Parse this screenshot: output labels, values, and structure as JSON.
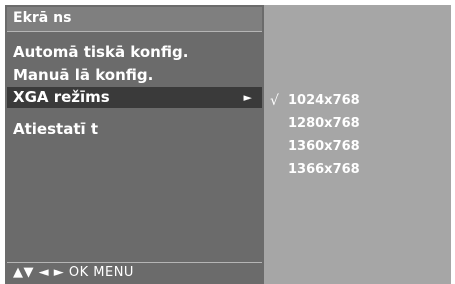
{
  "menu": {
    "title": "Ekrā ns",
    "items": [
      {
        "label": "Automā tiskā  konfig."
      },
      {
        "label": "Manuā lā  konfig."
      },
      {
        "label": "XGA režīms",
        "selected": true,
        "arrow": "►"
      },
      {
        "label": "Atiestatī t"
      }
    ],
    "hint": "▲▼  ◄ ►  OK  MENU"
  },
  "submenu": {
    "check_mark": "√",
    "options": [
      {
        "label": "1024x768",
        "checked": true
      },
      {
        "label": "1280x768"
      },
      {
        "label": "1360x768"
      },
      {
        "label": "1366x768"
      }
    ]
  },
  "colors": {
    "menu_bg": "#6b6b6b",
    "submenu_bg": "#a6a6a6",
    "selected_bg": "#3a3a3a"
  }
}
